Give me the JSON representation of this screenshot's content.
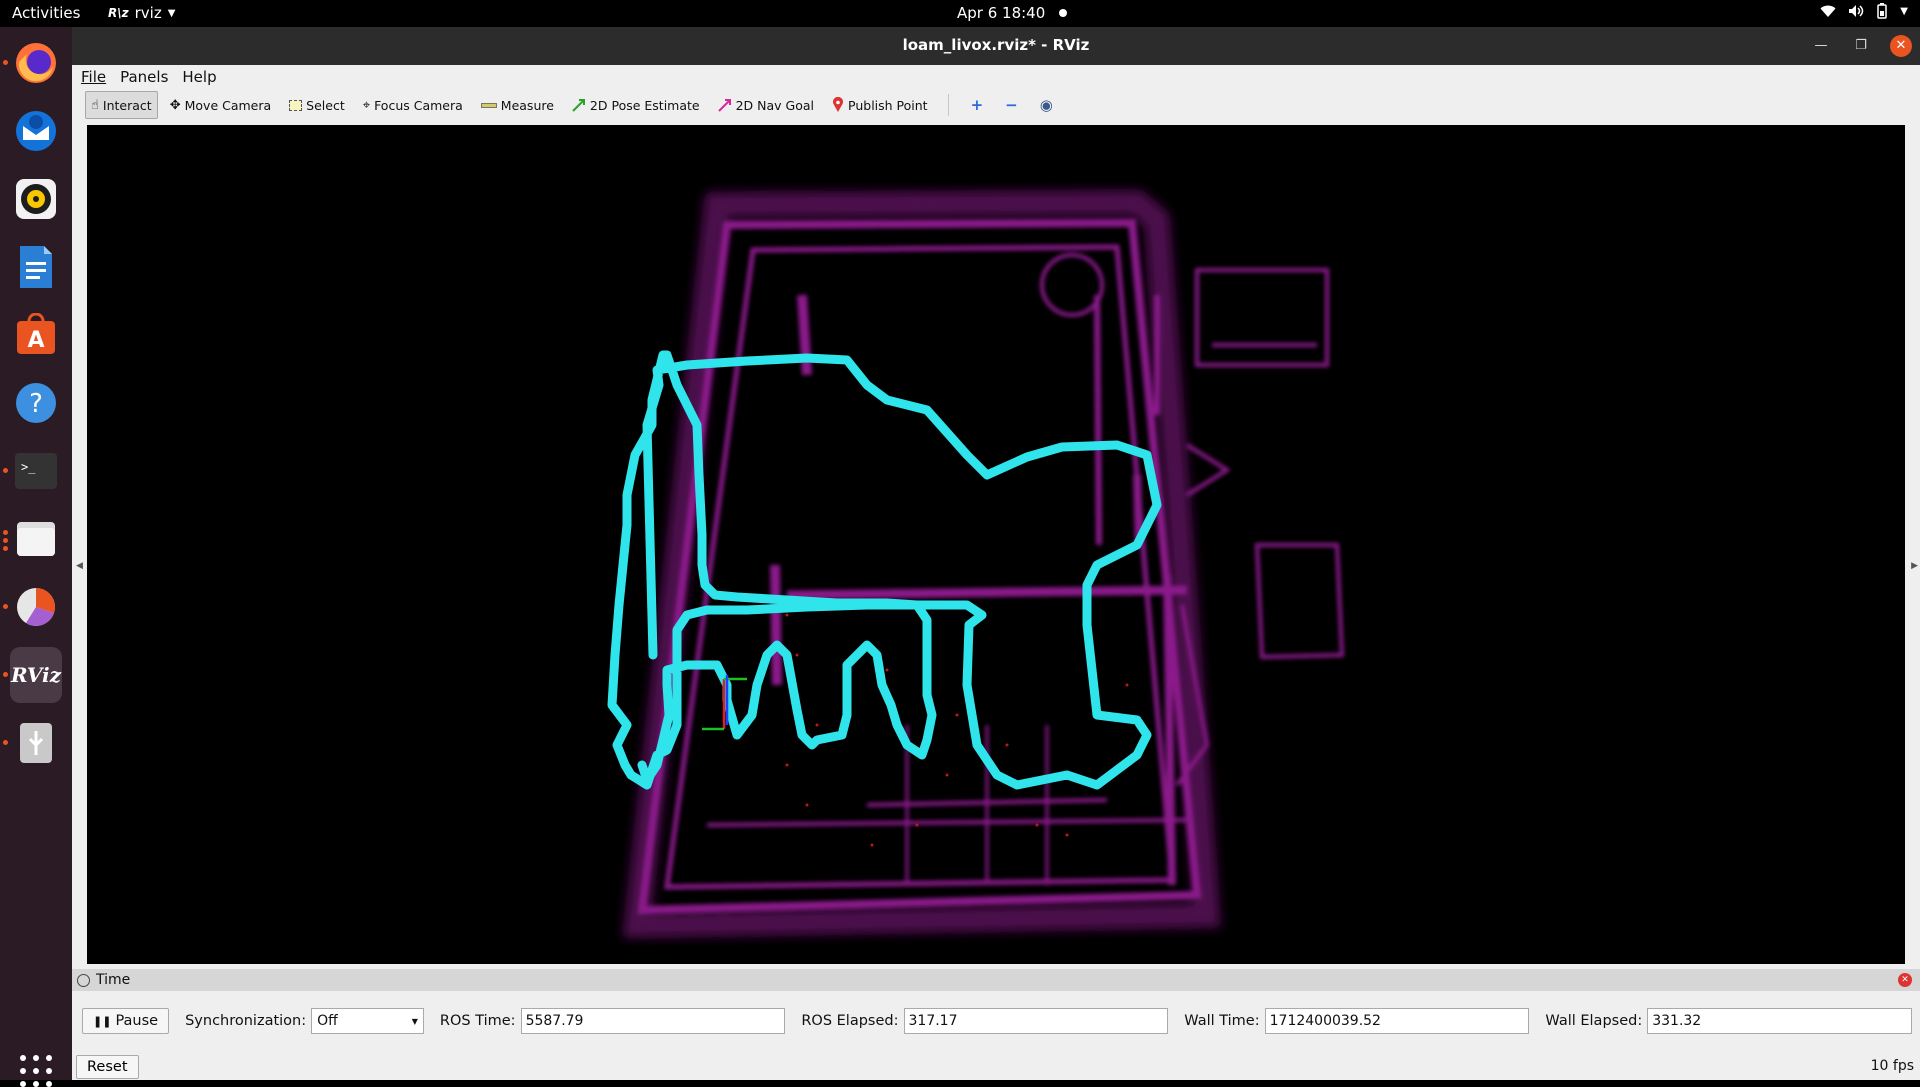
{
  "topbar": {
    "activities": "Activities",
    "app_name": "rviz",
    "app_icon_text": "R\\z",
    "clock": "Apr 6  18:40"
  },
  "dock": {
    "items": [
      {
        "name": "firefox-icon",
        "active": false,
        "running": true
      },
      {
        "name": "thunderbird-icon",
        "active": false,
        "running": false
      },
      {
        "name": "rhythmbox-icon",
        "active": false,
        "running": false
      },
      {
        "name": "libreoffice-writer-icon",
        "active": false,
        "running": false
      },
      {
        "name": "ubuntu-software-icon",
        "active": false,
        "running": false
      },
      {
        "name": "help-icon",
        "active": false,
        "running": false
      },
      {
        "name": "terminal-icon",
        "active": false,
        "running": true
      },
      {
        "name": "files-icon",
        "active": false,
        "running": true
      },
      {
        "name": "system-monitor-icon",
        "active": false,
        "running": true
      },
      {
        "name": "rviz-icon",
        "active": true,
        "running": true
      },
      {
        "name": "usb-icon",
        "active": false,
        "running": true
      }
    ],
    "rviz_label": "RViz"
  },
  "window": {
    "title": "loam_livox.rviz* - RViz"
  },
  "menu": {
    "file": "File",
    "panels": "Panels",
    "help": "Help"
  },
  "toolbar": {
    "interact": "Interact",
    "move_camera": "Move Camera",
    "select": "Select",
    "focus_camera": "Focus Camera",
    "measure": "Measure",
    "pose_estimate": "2D Pose Estimate",
    "nav_goal": "2D Nav Goal",
    "publish_point": "Publish Point"
  },
  "time_panel": {
    "title": "Time",
    "pause": "Pause",
    "sync_label": "Synchronization:",
    "sync_value": "Off",
    "ros_time_label": "ROS Time:",
    "ros_time": "5587.79",
    "ros_elapsed_label": "ROS Elapsed:",
    "ros_elapsed": "317.17",
    "wall_time_label": "Wall Time:",
    "wall_time": "1712400039.52",
    "wall_elapsed_label": "Wall Elapsed:",
    "wall_elapsed": "331.32",
    "reset": "Reset",
    "fps": "10 fps"
  },
  "colors": {
    "pointcloud": "#b022b0",
    "trajectory": "#30e4ec",
    "accent": "#e95420"
  }
}
